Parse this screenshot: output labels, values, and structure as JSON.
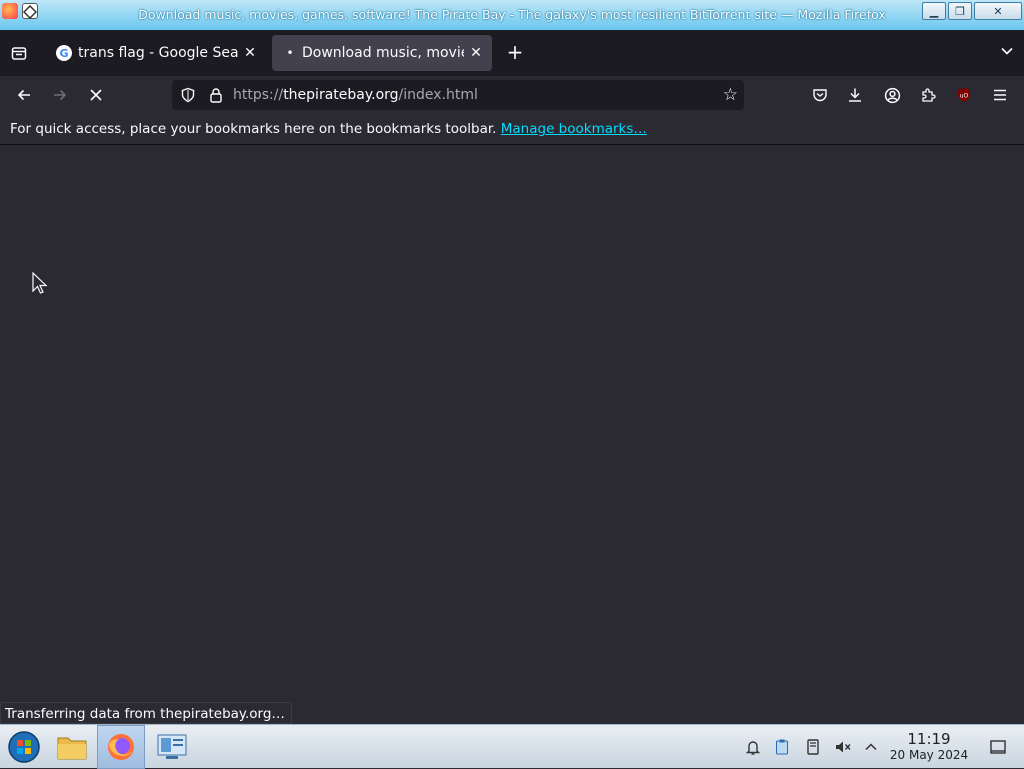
{
  "window": {
    "title": "Download music, movies, games, software! The Pirate Bay - The galaxy's most resilient BitTorrent site — Mozilla Firefox",
    "minimize_icon": "minimize-icon",
    "maximize_icon": "maximize-icon",
    "close_icon": "close-icon"
  },
  "tabs": [
    {
      "label": "trans flag - Google Search",
      "favicon": "G",
      "active": false
    },
    {
      "label": "Download music, movies, games",
      "active": true
    }
  ],
  "navbar": {
    "url_prefix": "https://",
    "url_domain": "thepiratebay.org",
    "url_path": "/index.html"
  },
  "bookmarks": {
    "message": "For quick access, place your bookmarks here on the bookmarks toolbar.",
    "manage_link": "Manage bookmarks…"
  },
  "status": {
    "text": "Transferring data from thepiratebay.org…"
  },
  "taskbar": {
    "time": "11:19",
    "date": "20 May 2024"
  },
  "colors": {
    "link": "#00ddff",
    "content_bg": "#2b2a33",
    "titlebar": "#6ac7ee"
  }
}
